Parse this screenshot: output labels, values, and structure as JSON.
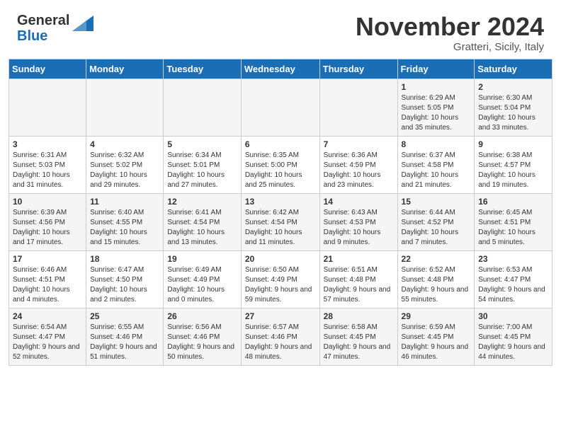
{
  "header": {
    "logo_line1": "General",
    "logo_line2": "Blue",
    "month": "November 2024",
    "location": "Gratteri, Sicily, Italy"
  },
  "days_of_week": [
    "Sunday",
    "Monday",
    "Tuesday",
    "Wednesday",
    "Thursday",
    "Friday",
    "Saturday"
  ],
  "weeks": [
    [
      {
        "day": "",
        "info": ""
      },
      {
        "day": "",
        "info": ""
      },
      {
        "day": "",
        "info": ""
      },
      {
        "day": "",
        "info": ""
      },
      {
        "day": "",
        "info": ""
      },
      {
        "day": "1",
        "info": "Sunrise: 6:29 AM\nSunset: 5:05 PM\nDaylight: 10 hours and 35 minutes."
      },
      {
        "day": "2",
        "info": "Sunrise: 6:30 AM\nSunset: 5:04 PM\nDaylight: 10 hours and 33 minutes."
      }
    ],
    [
      {
        "day": "3",
        "info": "Sunrise: 6:31 AM\nSunset: 5:03 PM\nDaylight: 10 hours and 31 minutes."
      },
      {
        "day": "4",
        "info": "Sunrise: 6:32 AM\nSunset: 5:02 PM\nDaylight: 10 hours and 29 minutes."
      },
      {
        "day": "5",
        "info": "Sunrise: 6:34 AM\nSunset: 5:01 PM\nDaylight: 10 hours and 27 minutes."
      },
      {
        "day": "6",
        "info": "Sunrise: 6:35 AM\nSunset: 5:00 PM\nDaylight: 10 hours and 25 minutes."
      },
      {
        "day": "7",
        "info": "Sunrise: 6:36 AM\nSunset: 4:59 PM\nDaylight: 10 hours and 23 minutes."
      },
      {
        "day": "8",
        "info": "Sunrise: 6:37 AM\nSunset: 4:58 PM\nDaylight: 10 hours and 21 minutes."
      },
      {
        "day": "9",
        "info": "Sunrise: 6:38 AM\nSunset: 4:57 PM\nDaylight: 10 hours and 19 minutes."
      }
    ],
    [
      {
        "day": "10",
        "info": "Sunrise: 6:39 AM\nSunset: 4:56 PM\nDaylight: 10 hours and 17 minutes."
      },
      {
        "day": "11",
        "info": "Sunrise: 6:40 AM\nSunset: 4:55 PM\nDaylight: 10 hours and 15 minutes."
      },
      {
        "day": "12",
        "info": "Sunrise: 6:41 AM\nSunset: 4:54 PM\nDaylight: 10 hours and 13 minutes."
      },
      {
        "day": "13",
        "info": "Sunrise: 6:42 AM\nSunset: 4:54 PM\nDaylight: 10 hours and 11 minutes."
      },
      {
        "day": "14",
        "info": "Sunrise: 6:43 AM\nSunset: 4:53 PM\nDaylight: 10 hours and 9 minutes."
      },
      {
        "day": "15",
        "info": "Sunrise: 6:44 AM\nSunset: 4:52 PM\nDaylight: 10 hours and 7 minutes."
      },
      {
        "day": "16",
        "info": "Sunrise: 6:45 AM\nSunset: 4:51 PM\nDaylight: 10 hours and 5 minutes."
      }
    ],
    [
      {
        "day": "17",
        "info": "Sunrise: 6:46 AM\nSunset: 4:51 PM\nDaylight: 10 hours and 4 minutes."
      },
      {
        "day": "18",
        "info": "Sunrise: 6:47 AM\nSunset: 4:50 PM\nDaylight: 10 hours and 2 minutes."
      },
      {
        "day": "19",
        "info": "Sunrise: 6:49 AM\nSunset: 4:49 PM\nDaylight: 10 hours and 0 minutes."
      },
      {
        "day": "20",
        "info": "Sunrise: 6:50 AM\nSunset: 4:49 PM\nDaylight: 9 hours and 59 minutes."
      },
      {
        "day": "21",
        "info": "Sunrise: 6:51 AM\nSunset: 4:48 PM\nDaylight: 9 hours and 57 minutes."
      },
      {
        "day": "22",
        "info": "Sunrise: 6:52 AM\nSunset: 4:48 PM\nDaylight: 9 hours and 55 minutes."
      },
      {
        "day": "23",
        "info": "Sunrise: 6:53 AM\nSunset: 4:47 PM\nDaylight: 9 hours and 54 minutes."
      }
    ],
    [
      {
        "day": "24",
        "info": "Sunrise: 6:54 AM\nSunset: 4:47 PM\nDaylight: 9 hours and 52 minutes."
      },
      {
        "day": "25",
        "info": "Sunrise: 6:55 AM\nSunset: 4:46 PM\nDaylight: 9 hours and 51 minutes."
      },
      {
        "day": "26",
        "info": "Sunrise: 6:56 AM\nSunset: 4:46 PM\nDaylight: 9 hours and 50 minutes."
      },
      {
        "day": "27",
        "info": "Sunrise: 6:57 AM\nSunset: 4:46 PM\nDaylight: 9 hours and 48 minutes."
      },
      {
        "day": "28",
        "info": "Sunrise: 6:58 AM\nSunset: 4:45 PM\nDaylight: 9 hours and 47 minutes."
      },
      {
        "day": "29",
        "info": "Sunrise: 6:59 AM\nSunset: 4:45 PM\nDaylight: 9 hours and 46 minutes."
      },
      {
        "day": "30",
        "info": "Sunrise: 7:00 AM\nSunset: 4:45 PM\nDaylight: 9 hours and 44 minutes."
      }
    ]
  ]
}
